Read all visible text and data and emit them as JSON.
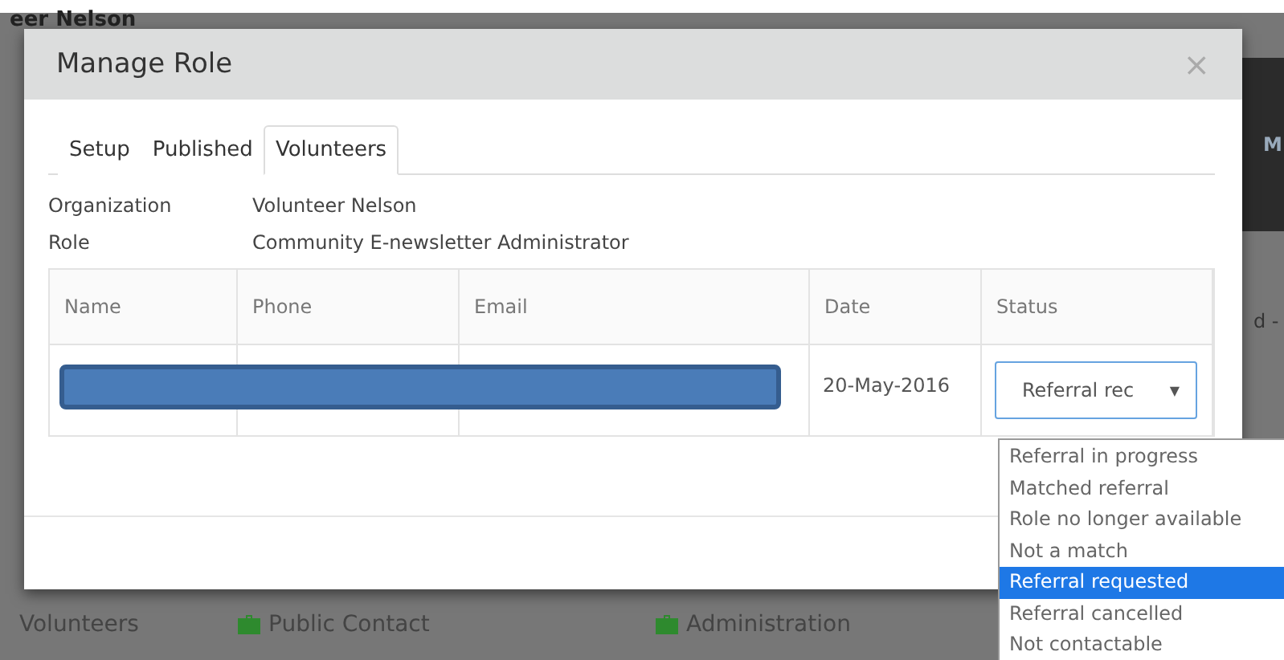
{
  "background": {
    "page_title": "eer Nelson",
    "right_fragment_top": "M",
    "right_fragment_middle": "d -",
    "bottom_items": [
      {
        "label": "Volunteers",
        "icon": false
      },
      {
        "label": "Public Contact",
        "icon": true
      },
      {
        "label": "Administration",
        "icon": true
      }
    ]
  },
  "dialog": {
    "title": "Manage Role",
    "close": "×",
    "tabs": [
      {
        "label": "Setup",
        "selected": false
      },
      {
        "label": "Published",
        "selected": false
      },
      {
        "label": "Volunteers",
        "selected": true
      }
    ],
    "fields": [
      {
        "label": "Organization",
        "value": "Volunteer Nelson"
      },
      {
        "label": "Role",
        "value": "Community E-newsletter Administrator"
      }
    ],
    "table": {
      "columns": [
        "Name",
        "Phone",
        "Email",
        "Date",
        "Status"
      ],
      "rows": [
        {
          "date": "20-May-2016",
          "status": {
            "value": "Referral rec",
            "caret": "▼",
            "options": [
              {
                "label": "Referral in progress",
                "selected": false
              },
              {
                "label": "Matched referral",
                "selected": false
              },
              {
                "label": "Role no longer available",
                "selected": false
              },
              {
                "label": "Not a match",
                "selected": false
              },
              {
                "label": "Referral requested",
                "selected": true
              },
              {
                "label": "Referral cancelled",
                "selected": false
              },
              {
                "label": "Not contactable",
                "selected": false
              }
            ]
          }
        }
      ]
    }
  }
}
